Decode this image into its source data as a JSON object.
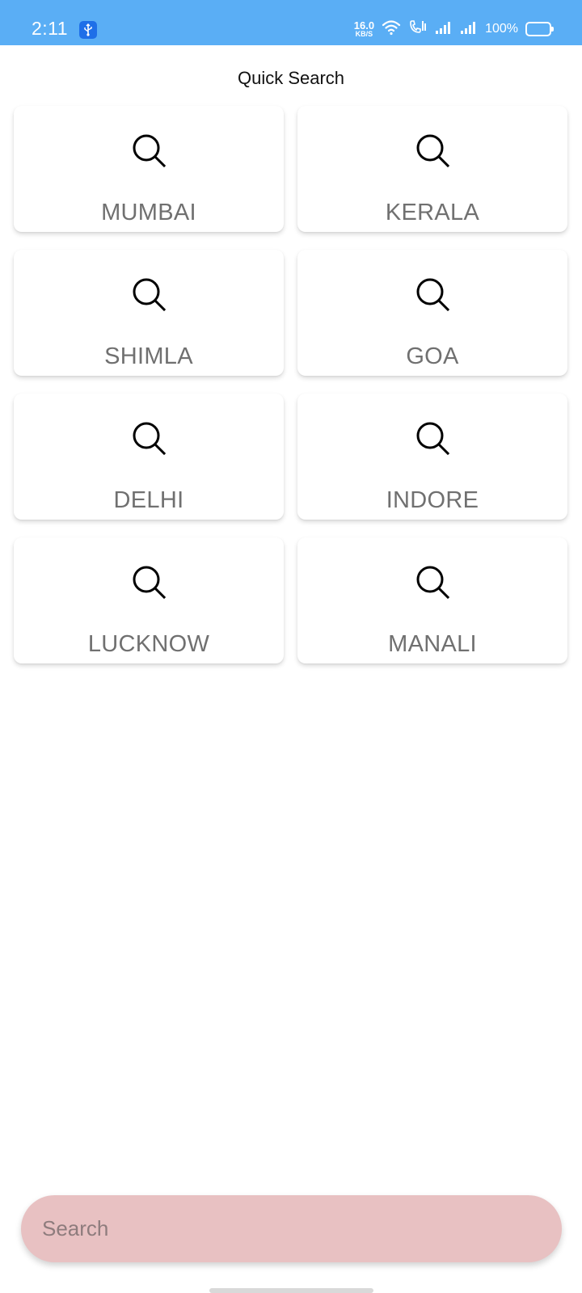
{
  "status_bar": {
    "time": "2:11",
    "network_speed_value": "16.0",
    "network_speed_unit": "KB/S",
    "battery_percent": "100%",
    "background_color": "#5aaef5"
  },
  "header": {
    "title": "Quick Search"
  },
  "quick_search": {
    "icon": "search-icon",
    "items": [
      {
        "label": "MUMBAI"
      },
      {
        "label": "KERALA"
      },
      {
        "label": "SHIMLA"
      },
      {
        "label": "GOA"
      },
      {
        "label": "DELHI"
      },
      {
        "label": "INDORE"
      },
      {
        "label": "LUCKNOW"
      },
      {
        "label": "MANALI"
      }
    ]
  },
  "search": {
    "placeholder": "Search",
    "value": "",
    "background_color": "#e8c1c2"
  }
}
